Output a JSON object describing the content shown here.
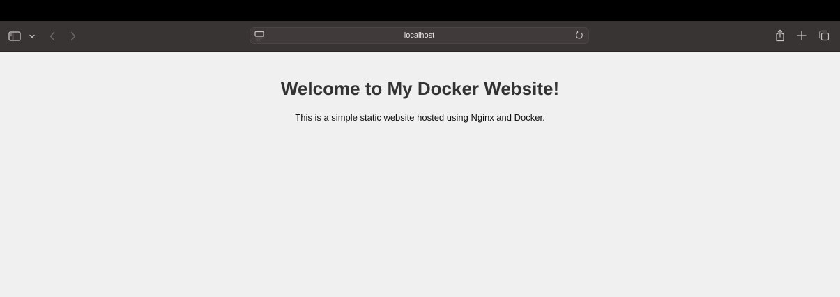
{
  "browser": {
    "address_bar": {
      "url": "localhost",
      "page_icon": "page-menu-icon",
      "reload_icon": "reload-icon"
    },
    "toolbar_icons": {
      "sidebar": "sidebar-icon",
      "sidebar_menu": "chevron-down-icon",
      "back": "chevron-left-icon",
      "forward": "chevron-right-icon",
      "share": "share-icon",
      "new_tab": "plus-icon",
      "tab_overview": "tabs-icon"
    },
    "colors": {
      "top_strip": "#000000",
      "toolbar": "#383433",
      "address_bar": "#403b3a",
      "page_background": "#f0f0f0"
    }
  },
  "page": {
    "heading": "Welcome to My Docker Website!",
    "paragraph": "This is a simple static website hosted using Nginx and Docker."
  }
}
